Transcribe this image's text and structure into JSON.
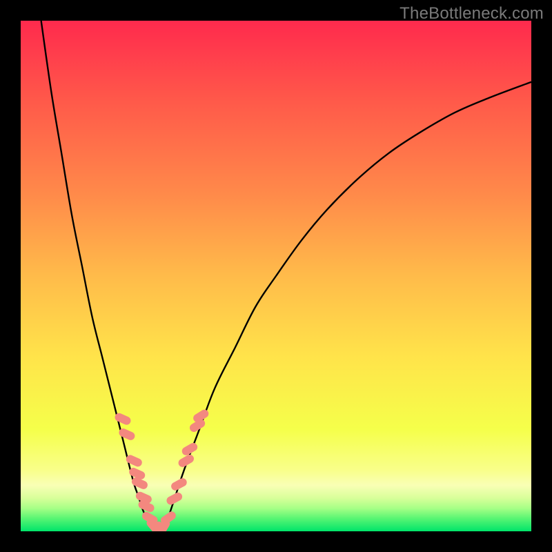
{
  "watermark": "TheBottleneck.com",
  "chart_data": {
    "type": "line",
    "title": "",
    "xlabel": "",
    "ylabel": "",
    "xlim": [
      0,
      100
    ],
    "ylim": [
      0,
      100
    ],
    "grid": false,
    "legend": false,
    "annotations": [],
    "background_gradient": {
      "top": "#ff2a4d",
      "mid_upper": "#ffb24a",
      "mid": "#ffe44a",
      "mid_lower": "#f1ff4a",
      "green_band": "#c6ff84",
      "bottom": "#00e46a"
    },
    "series": [
      {
        "name": "left-curve",
        "stroke": "#000000",
        "x": [
          4,
          6,
          8,
          10,
          12,
          14,
          16,
          18,
          20,
          22,
          23,
          24,
          25,
          26
        ],
        "y": [
          100,
          86,
          74,
          62,
          52,
          42,
          34,
          26,
          18,
          10,
          7,
          4,
          2,
          0
        ]
      },
      {
        "name": "right-curve",
        "stroke": "#000000",
        "x": [
          28,
          30,
          32,
          35,
          38,
          42,
          46,
          50,
          55,
          60,
          66,
          72,
          78,
          85,
          92,
          100
        ],
        "y": [
          0,
          6,
          12,
          20,
          28,
          36,
          44,
          50,
          57,
          63,
          69,
          74,
          78,
          82,
          85,
          88
        ]
      },
      {
        "name": "markers",
        "type": "scatter",
        "fill": "#f3887f",
        "stroke": "#f3887f",
        "points": [
          {
            "x": 20.0,
            "y": 22.0,
            "rot": -66
          },
          {
            "x": 20.8,
            "y": 19.0,
            "rot": -66
          },
          {
            "x": 22.2,
            "y": 13.8,
            "rot": -66
          },
          {
            "x": 22.8,
            "y": 11.3,
            "rot": -66
          },
          {
            "x": 23.3,
            "y": 9.4,
            "rot": -66
          },
          {
            "x": 24.1,
            "y": 6.6,
            "rot": -66
          },
          {
            "x": 24.6,
            "y": 4.9,
            "rot": -66
          },
          {
            "x": 25.3,
            "y": 2.6,
            "rot": -60
          },
          {
            "x": 26.0,
            "y": 1.0,
            "rot": -40
          },
          {
            "x": 27.0,
            "y": 0.3,
            "rot": 0
          },
          {
            "x": 28.0,
            "y": 0.8,
            "rot": 30
          },
          {
            "x": 28.9,
            "y": 2.6,
            "rot": 55
          },
          {
            "x": 30.1,
            "y": 6.4,
            "rot": 62
          },
          {
            "x": 31.0,
            "y": 9.2,
            "rot": 62
          },
          {
            "x": 32.4,
            "y": 13.8,
            "rot": 60
          },
          {
            "x": 33.1,
            "y": 16.1,
            "rot": 60
          },
          {
            "x": 34.6,
            "y": 20.7,
            "rot": 58
          },
          {
            "x": 35.3,
            "y": 22.6,
            "rot": 58
          }
        ]
      }
    ]
  }
}
